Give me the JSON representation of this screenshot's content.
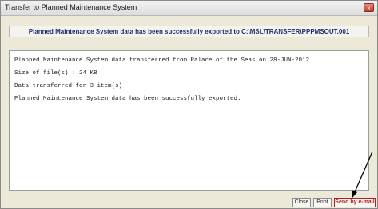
{
  "window": {
    "title": "Transfer to Planned Maintenance System",
    "close_glyph": "×"
  },
  "banner": {
    "message": "Planned Maintenance System data has been successfully exported to C:\\MSL\\TRANSFER\\PPPMSOUT.001"
  },
  "log": {
    "lines": [
      "Planned Maintenance System data transferred from Palace of the Seas on 28-JUN-2012",
      "Size of file(s) : 24 KB",
      "Data transferred for 3 item(s)",
      "Planned Maintenance System data has been successfully exported."
    ]
  },
  "buttons": {
    "close": "Close",
    "print": "Print",
    "email": "Send by e-mail"
  },
  "colors": {
    "email_accent": "#b81d1d",
    "banner_text": "#1f2e6a"
  }
}
